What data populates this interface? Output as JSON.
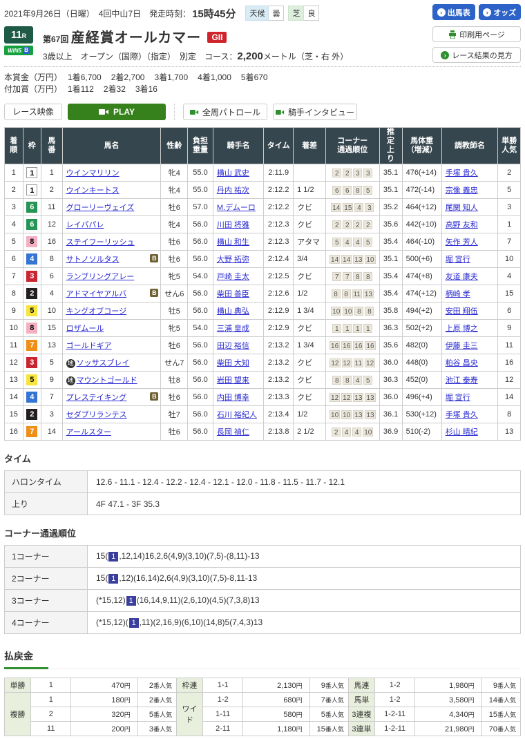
{
  "page": {
    "date_line": "2021年9月26日（日曜）　4回中山7日　",
    "start_label": "発走時刻：",
    "start_time": "15時45分",
    "weather_label": "天候",
    "weather_value": "曇",
    "turf_label": "芝",
    "turf_value": "良",
    "btn_shutsuba": "出馬表",
    "btn_odds": "オッズ",
    "race_no": "11",
    "race_no_suffix": "R",
    "win5": "WIN5",
    "win5_b": "B",
    "race_title_prefix": "第67回",
    "race_title": "産経賞オールカマー",
    "grade": "GII",
    "conditions_pre": "3歳以上　オープン（国際）（指定）　別定　コース：",
    "course_distance": "2,200",
    "conditions_post": "メートル（芝・右 外）",
    "btn_print": "印刷用ページ",
    "btn_guide": "レース結果の見方",
    "prize1_label": "本賞金（万円）",
    "prize2_label": "付加賞（万円）",
    "prize1": [
      [
        "1着",
        "6,700"
      ],
      [
        "2着",
        "2,700"
      ],
      [
        "3着",
        "1,700"
      ],
      [
        "4着",
        "1,000"
      ],
      [
        "5着",
        "670"
      ]
    ],
    "prize2": [
      [
        "1着",
        "112"
      ],
      [
        "2着",
        "32"
      ],
      [
        "3着",
        "16"
      ]
    ],
    "video_label": "レース映像",
    "btn_play": "PLAY",
    "btn_patrol": "全周パトロール",
    "btn_interview": "騎手インタビュー"
  },
  "colors": {
    "accent_blue": "#2d63c8",
    "accent_green": "#37811c",
    "grade_red": "#d0242c",
    "table_header_bg": "#36464e",
    "link_blue": "#2a2ad2",
    "corner_hl_bg": "#3a3f9e",
    "payout_label_bg": "#e9efdd",
    "win5_green": "#15a23e",
    "race_no_green": "#1f5a46"
  },
  "results": {
    "headers": [
      "着順",
      "枠",
      "馬\n番",
      "馬名",
      "性齢",
      "負担\n重量",
      "騎手名",
      "タイム",
      "着差",
      "コーナー\n通過順位",
      "推\n定\n上\nり",
      "馬体重\n（増減）",
      "調教師名",
      "単勝\n人気"
    ],
    "runners": [
      {
        "pos": "1",
        "frame": 1,
        "num": "1",
        "mark": "",
        "name": "ウインマリリン",
        "b": false,
        "sex_age": "牝4",
        "weight": "55.0",
        "jockey": "横山 武史",
        "time": "2:11.9",
        "margin": "",
        "corners": [
          "2",
          "2",
          "3",
          "3"
        ],
        "last3f": "35.1",
        "horse_weight": "476(+14)",
        "trainer": "手塚 貴久",
        "fav": "2"
      },
      {
        "pos": "2",
        "frame": 1,
        "num": "2",
        "mark": "",
        "name": "ウインキートス",
        "b": false,
        "sex_age": "牝4",
        "weight": "55.0",
        "jockey": "丹内 祐次",
        "time": "2:12.2",
        "margin": "1 1/2",
        "corners": [
          "6",
          "6",
          "8",
          "5"
        ],
        "last3f": "35.1",
        "horse_weight": "472(-14)",
        "trainer": "宗像 義忠",
        "fav": "5"
      },
      {
        "pos": "3",
        "frame": 6,
        "num": "11",
        "mark": "",
        "name": "グローリーヴェイズ",
        "b": false,
        "sex_age": "牡6",
        "weight": "57.0",
        "jockey": "M.デムーロ",
        "time": "2:12.2",
        "margin": "クビ",
        "corners": [
          "14",
          "15",
          "4",
          "3"
        ],
        "last3f": "35.2",
        "horse_weight": "464(+12)",
        "trainer": "尾関 知人",
        "fav": "3"
      },
      {
        "pos": "4",
        "frame": 6,
        "num": "12",
        "mark": "",
        "name": "レイパパレ",
        "b": false,
        "sex_age": "牝4",
        "weight": "56.0",
        "jockey": "川田 将雅",
        "time": "2:12.3",
        "margin": "クビ",
        "corners": [
          "2",
          "2",
          "2",
          "2"
        ],
        "last3f": "35.6",
        "horse_weight": "442(+10)",
        "trainer": "高野 友和",
        "fav": "1"
      },
      {
        "pos": "5",
        "frame": 8,
        "num": "16",
        "mark": "",
        "name": "ステイフーリッシュ",
        "b": false,
        "sex_age": "牡6",
        "weight": "56.0",
        "jockey": "横山 和生",
        "time": "2:12.3",
        "margin": "アタマ",
        "corners": [
          "5",
          "4",
          "4",
          "5"
        ],
        "last3f": "35.4",
        "horse_weight": "464(-10)",
        "trainer": "矢作 芳人",
        "fav": "7"
      },
      {
        "pos": "6",
        "frame": 4,
        "num": "8",
        "mark": "",
        "name": "サトノソルタス",
        "b": true,
        "sex_age": "牡6",
        "weight": "56.0",
        "jockey": "大野 拓弥",
        "time": "2:12.4",
        "margin": "3/4",
        "corners": [
          "14",
          "14",
          "13",
          "10"
        ],
        "last3f": "35.1",
        "horse_weight": "500(+6)",
        "trainer": "堀 宣行",
        "fav": "10"
      },
      {
        "pos": "7",
        "frame": 3,
        "num": "6",
        "mark": "",
        "name": "ランブリングアレー",
        "b": false,
        "sex_age": "牝5",
        "weight": "54.0",
        "jockey": "戸崎 圭太",
        "time": "2:12.5",
        "margin": "クビ",
        "corners": [
          "7",
          "7",
          "8",
          "8"
        ],
        "last3f": "35.4",
        "horse_weight": "474(+8)",
        "trainer": "友道 康夫",
        "fav": "4"
      },
      {
        "pos": "8",
        "frame": 2,
        "num": "4",
        "mark": "",
        "name": "アドマイヤアルバ",
        "b": true,
        "sex_age": "せん6",
        "weight": "56.0",
        "jockey": "柴田 善臣",
        "time": "2:12.6",
        "margin": "1/2",
        "corners": [
          "8",
          "8",
          "11",
          "13"
        ],
        "last3f": "35.4",
        "horse_weight": "474(+12)",
        "trainer": "柄崎 孝",
        "fav": "15"
      },
      {
        "pos": "9",
        "frame": 5,
        "num": "10",
        "mark": "",
        "name": "キングオブコージ",
        "b": false,
        "sex_age": "牡5",
        "weight": "56.0",
        "jockey": "横山 典弘",
        "time": "2:12.9",
        "margin": "1 3/4",
        "corners": [
          "10",
          "10",
          "8",
          "8"
        ],
        "last3f": "35.8",
        "horse_weight": "494(+2)",
        "trainer": "安田 翔伍",
        "fav": "6"
      },
      {
        "pos": "10",
        "frame": 8,
        "num": "15",
        "mark": "",
        "name": "ロザムール",
        "b": false,
        "sex_age": "牝5",
        "weight": "54.0",
        "jockey": "三浦 皇成",
        "time": "2:12.9",
        "margin": "クビ",
        "corners": [
          "1",
          "1",
          "1",
          "1"
        ],
        "last3f": "36.3",
        "horse_weight": "502(+2)",
        "trainer": "上原 博之",
        "fav": "9"
      },
      {
        "pos": "11",
        "frame": 7,
        "num": "13",
        "mark": "",
        "name": "ゴールドギア",
        "b": false,
        "sex_age": "牡6",
        "weight": "56.0",
        "jockey": "田辺 裕信",
        "time": "2:13.2",
        "margin": "1 3/4",
        "corners": [
          "16",
          "16",
          "16",
          "16"
        ],
        "last3f": "35.6",
        "horse_weight": "482(0)",
        "trainer": "伊藤 圭三",
        "fav": "11"
      },
      {
        "pos": "12",
        "frame": 3,
        "num": "5",
        "mark": "地",
        "name": "ソッサスブレイ",
        "b": false,
        "sex_age": "せん7",
        "weight": "56.0",
        "jockey": "柴田 大知",
        "time": "2:13.2",
        "margin": "クビ",
        "corners": [
          "12",
          "12",
          "11",
          "12"
        ],
        "last3f": "36.0",
        "horse_weight": "448(0)",
        "trainer": "粕谷 昌央",
        "fav": "16"
      },
      {
        "pos": "13",
        "frame": 5,
        "num": "9",
        "mark": "地",
        "name": "マウントゴールド",
        "b": false,
        "sex_age": "牡8",
        "weight": "56.0",
        "jockey": "岩田 望来",
        "time": "2:13.2",
        "margin": "クビ",
        "corners": [
          "8",
          "8",
          "4",
          "5"
        ],
        "last3f": "36.3",
        "horse_weight": "452(0)",
        "trainer": "池江 泰寿",
        "fav": "12"
      },
      {
        "pos": "14",
        "frame": 4,
        "num": "7",
        "mark": "",
        "name": "プレステイキング",
        "b": true,
        "sex_age": "牡6",
        "weight": "56.0",
        "jockey": "内田 博幸",
        "time": "2:13.3",
        "margin": "クビ",
        "corners": [
          "12",
          "12",
          "13",
          "13"
        ],
        "last3f": "36.0",
        "horse_weight": "496(+4)",
        "trainer": "堀 宣行",
        "fav": "14"
      },
      {
        "pos": "15",
        "frame": 2,
        "num": "3",
        "mark": "",
        "name": "セダブリランテス",
        "b": false,
        "sex_age": "牡7",
        "weight": "56.0",
        "jockey": "石川 裕紀人",
        "time": "2:13.4",
        "margin": "1/2",
        "corners": [
          "10",
          "10",
          "13",
          "13"
        ],
        "last3f": "36.1",
        "horse_weight": "530(+12)",
        "trainer": "手塚 貴久",
        "fav": "8"
      },
      {
        "pos": "16",
        "frame": 7,
        "num": "14",
        "mark": "",
        "name": "アールスター",
        "b": false,
        "sex_age": "牡6",
        "weight": "56.0",
        "jockey": "長岡 禎仁",
        "time": "2:13.8",
        "margin": "2 1/2",
        "corners": [
          "2",
          "4",
          "4",
          "10"
        ],
        "last3f": "36.9",
        "horse_weight": "510(-2)",
        "trainer": "杉山 晴紀",
        "fav": "13"
      }
    ]
  },
  "time_section": {
    "title": "タイム",
    "rows": [
      [
        "ハロンタイム",
        "12.6 - 11.1 - 12.4 - 12.2 - 12.4 - 12.1 - 12.0 - 11.8 - 11.5 - 11.7 - 12.1"
      ],
      [
        "上り",
        "4F 47.1 - 3F 35.3"
      ]
    ]
  },
  "corner_section": {
    "title": "コーナー通過順位",
    "rows": [
      {
        "label": "1コーナー",
        "pre": "15(",
        "hl": "1",
        "post": ",12,14)16,2,6(4,9)(3,10)(7,5)-(8,11)-13"
      },
      {
        "label": "2コーナー",
        "pre": "15(",
        "hl": "1",
        "post": ",12)(16,14)2,6(4,9)(3,10)(7,5)-8,11-13"
      },
      {
        "label": "3コーナー",
        "pre": "(*15,12)",
        "hl": "1",
        "post": "(16,14,9,11)(2,6,10)(4,5)(7,3,8)13"
      },
      {
        "label": "4コーナー",
        "pre": "(*15,12)(",
        "hl": "1",
        "post": ",11)(2,16,9)(6,10)(14,8)5(7,4,3)13"
      }
    ]
  },
  "payout_section": {
    "title": "払戻金",
    "units": {
      "yen": "円",
      "fav": "番人気"
    },
    "groups": [
      {
        "bets": [
          {
            "label": "単勝",
            "rows": [
              {
                "combo": "1",
                "amount": "470",
                "fav": "2"
              }
            ]
          },
          {
            "label": "複勝",
            "rows": [
              {
                "combo": "1",
                "amount": "180",
                "fav": "2"
              },
              {
                "combo": "2",
                "amount": "320",
                "fav": "5"
              },
              {
                "combo": "11",
                "amount": "200",
                "fav": "3"
              }
            ]
          }
        ]
      },
      {
        "bets": [
          {
            "label": "枠連",
            "rows": [
              {
                "combo": "1-1",
                "amount": "2,130",
                "fav": "9"
              }
            ]
          },
          {
            "label": "ワイド",
            "rows": [
              {
                "combo": "1-2",
                "amount": "680",
                "fav": "7"
              },
              {
                "combo": "1-11",
                "amount": "580",
                "fav": "5"
              },
              {
                "combo": "2-11",
                "amount": "1,180",
                "fav": "15"
              }
            ]
          }
        ]
      },
      {
        "bets": [
          {
            "label": "馬連",
            "rows": [
              {
                "combo": "1-2",
                "amount": "1,980",
                "fav": "9"
              }
            ]
          },
          {
            "label": "馬単",
            "rows": [
              {
                "combo": "1-2",
                "amount": "3,580",
                "fav": "14"
              }
            ]
          },
          {
            "label": "3連複",
            "rows": [
              {
                "combo": "1-2-11",
                "amount": "4,340",
                "fav": "15"
              }
            ]
          },
          {
            "label": "3連単",
            "rows": [
              {
                "combo": "1-2-11",
                "amount": "21,980",
                "fav": "70"
              }
            ]
          }
        ]
      }
    ]
  }
}
